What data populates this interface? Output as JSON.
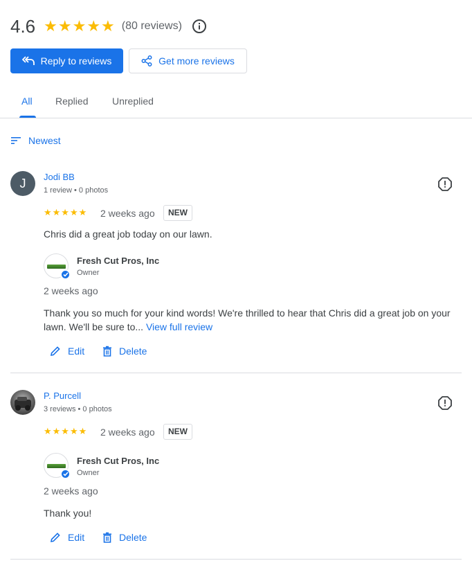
{
  "summary": {
    "rating": "4.6",
    "stars": "★★★★★",
    "reviews_count": "(80 reviews)",
    "info_icon": "info-icon"
  },
  "actions": {
    "reply_label": "Reply to reviews",
    "get_more_label": "Get more reviews"
  },
  "tabs": [
    {
      "label": "All",
      "active": true
    },
    {
      "label": "Replied"
    },
    {
      "label": "Unreplied"
    }
  ],
  "sort": {
    "label": "Newest"
  },
  "reviews": [
    {
      "avatar_letter": "J",
      "name": "Jodi BB",
      "meta": "1 review • 0 photos",
      "stars": "★★★★★",
      "date": "2 weeks ago",
      "badge": "NEW",
      "text": "Chris did a great job today on our lawn.",
      "owner": {
        "name": "Fresh Cut Pros, Inc",
        "role": "Owner"
      },
      "reply_date": "2 weeks ago",
      "reply_text": "Thank you so much for your kind words! We're thrilled to hear that Chris did a great job on your lawn. We'll be sure to...",
      "view_full": "View full review",
      "edit_label": "Edit",
      "delete_label": "Delete"
    },
    {
      "avatar_letter": "",
      "name": "P. Purcell",
      "meta": "3 reviews • 0 photos",
      "stars": "★★★★★",
      "date": "2 weeks ago",
      "badge": "NEW",
      "text": "",
      "owner": {
        "name": "Fresh Cut Pros, Inc",
        "role": "Owner"
      },
      "reply_date": "2 weeks ago",
      "reply_text": "Thank you!",
      "edit_label": "Edit",
      "delete_label": "Delete"
    }
  ],
  "colors": {
    "accent": "#1a73e8",
    "star": "#fbbc04",
    "muted": "#5f6368",
    "divider": "#dadce0"
  }
}
